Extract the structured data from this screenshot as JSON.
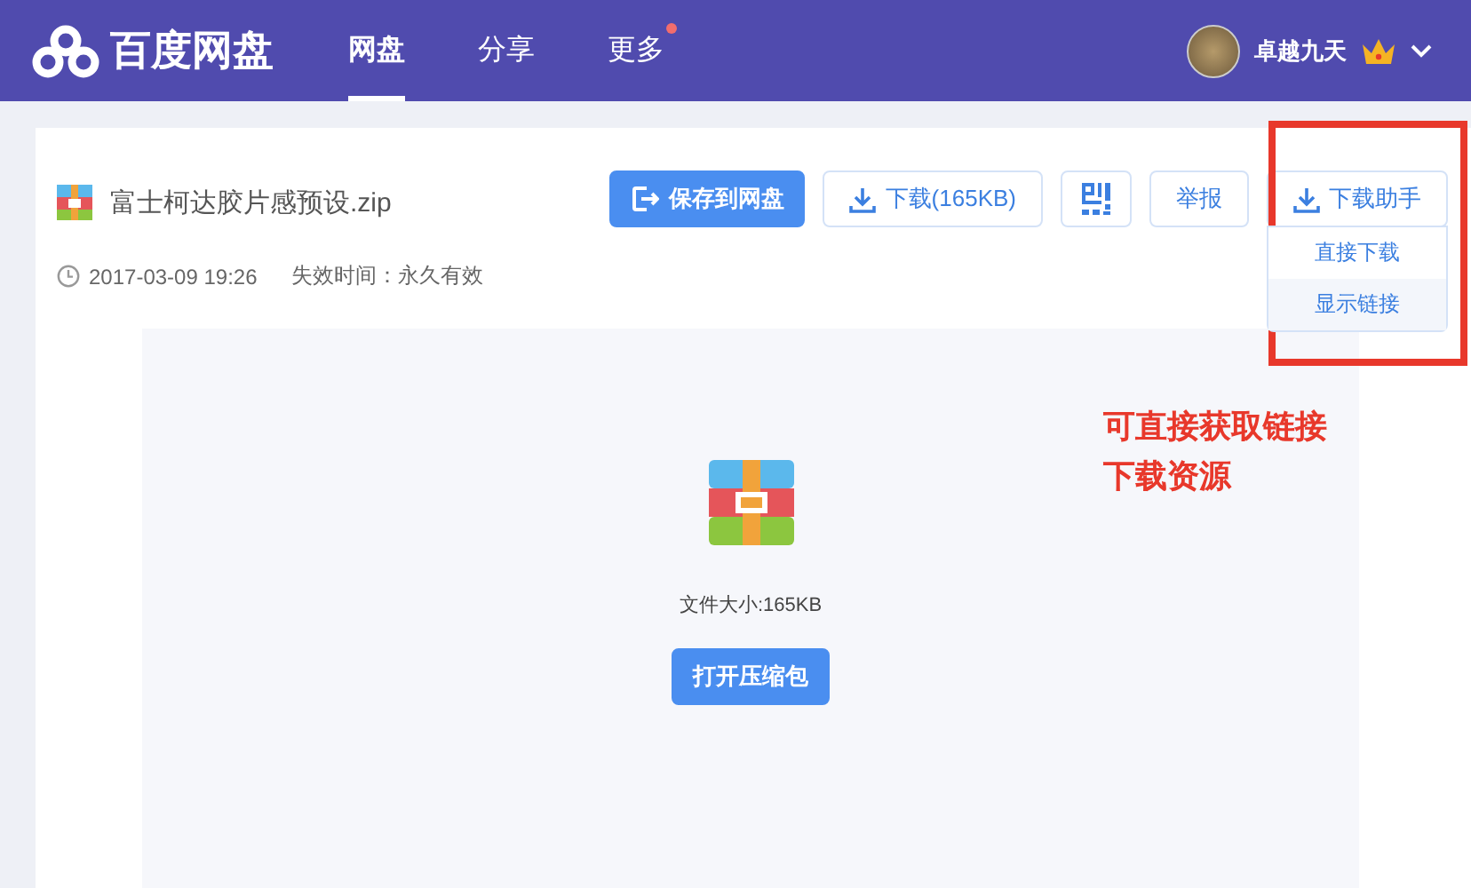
{
  "header": {
    "logo": "百度网盘",
    "nav": [
      {
        "label": "网盘",
        "selected": true,
        "badge": false
      },
      {
        "label": "分享",
        "selected": false,
        "badge": false
      },
      {
        "label": "更多",
        "selected": false,
        "badge": true
      }
    ],
    "user": {
      "name": "卓越九天",
      "vip": true
    }
  },
  "file": {
    "name": "富士柯达胶片感预设.zip",
    "date": "2017-03-09 19:26",
    "expiry": "失效时间：永久有效"
  },
  "actions": [
    {
      "kind": "save",
      "label": "保存到网盘"
    },
    {
      "kind": "download",
      "label": "下载(165KB)"
    },
    {
      "kind": "qr"
    },
    {
      "kind": "text",
      "label": "举报"
    },
    {
      "kind": "download",
      "label": "下载助手",
      "expanded": true
    }
  ],
  "dropdown": [
    {
      "label": "直接下载",
      "selected": false
    },
    {
      "label": "显示链接",
      "selected": true
    }
  ],
  "preview": {
    "size": "文件大小:165KB",
    "button": "打开压缩包"
  },
  "annotation": [
    "可直接获取链接",
    "下载资源"
  ]
}
